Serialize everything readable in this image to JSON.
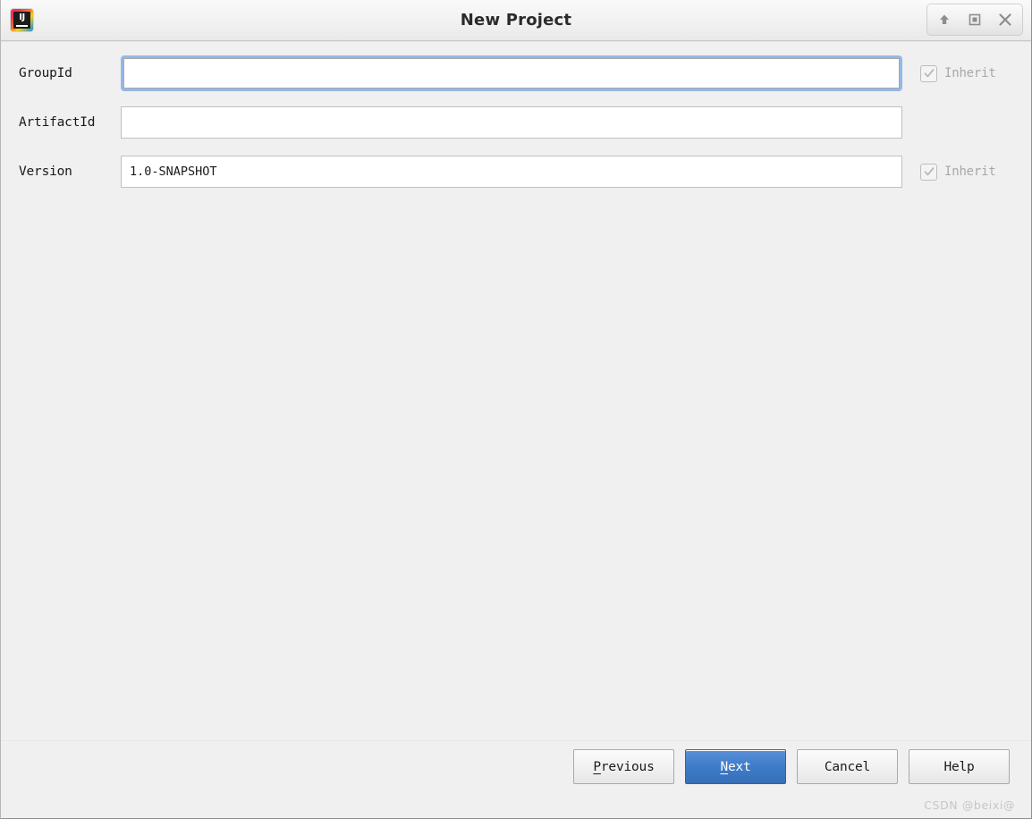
{
  "window": {
    "title": "New Project",
    "app_icon_name": "intellij-idea-icon",
    "app_icon_text": "IJ",
    "controls": [
      {
        "name": "shade-up-button",
        "icon": "arrow-up-icon"
      },
      {
        "name": "maximize-button",
        "icon": "maximize-square-icon"
      },
      {
        "name": "close-button",
        "icon": "close-x-icon"
      }
    ]
  },
  "form": {
    "rows": [
      {
        "label": "GroupId",
        "value": "",
        "placeholder": "",
        "focused": true,
        "inherit": {
          "label": "Inherit",
          "checked": true,
          "enabled": false
        }
      },
      {
        "label": "ArtifactId",
        "value": "",
        "placeholder": "",
        "focused": false,
        "inherit": null
      },
      {
        "label": "Version",
        "value": "1.0-SNAPSHOT",
        "placeholder": "",
        "focused": false,
        "inherit": {
          "label": "Inherit",
          "checked": true,
          "enabled": false
        }
      }
    ]
  },
  "footer": {
    "buttons": [
      {
        "name": "previous-button",
        "label": "Previous",
        "mnemonic": "P",
        "primary": false
      },
      {
        "name": "next-button",
        "label": "Next",
        "mnemonic": "N",
        "primary": true
      },
      {
        "name": "cancel-button",
        "label": "Cancel",
        "mnemonic": "",
        "primary": false
      },
      {
        "name": "help-button",
        "label": "Help",
        "mnemonic": "",
        "primary": false
      }
    ],
    "watermark": "CSDN @beixi@"
  },
  "colors": {
    "primary_button": "#3e7cc8",
    "focus_ring": "#94b8e8",
    "window_bg": "#f0f0f0",
    "disabled_text": "#a8a8a8"
  }
}
